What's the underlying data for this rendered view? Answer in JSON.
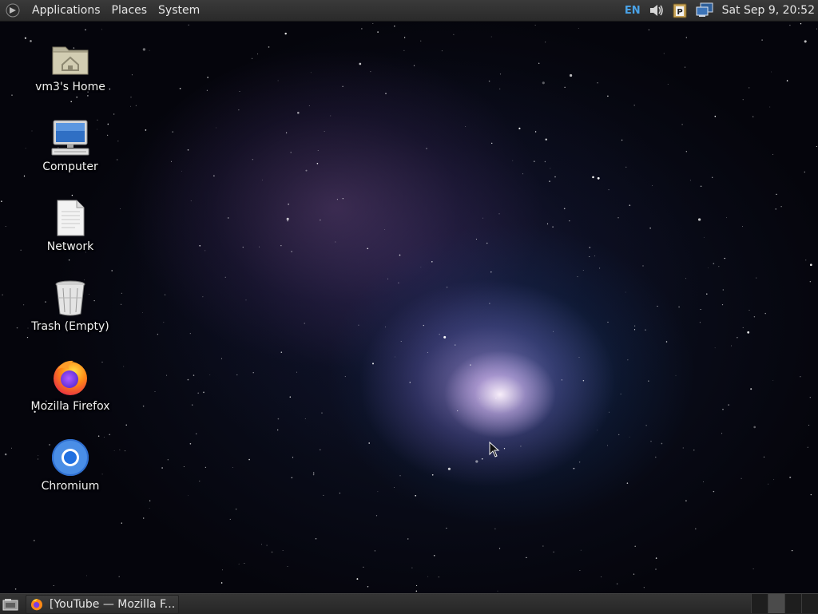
{
  "top_panel": {
    "menus": [
      "Applications",
      "Places",
      "System"
    ],
    "tray": {
      "keyboard_layout": "EN",
      "icons": [
        "volume-icon",
        "clipboard-icon",
        "network-icon"
      ]
    },
    "clock": "Sat Sep  9, 20:52"
  },
  "desktop": {
    "icons": [
      {
        "label": "vm3's Home",
        "icon": "home-folder-icon"
      },
      {
        "label": "Computer",
        "icon": "computer-icon"
      },
      {
        "label": "Network",
        "icon": "network-document-icon"
      },
      {
        "label": "Trash (Empty)",
        "icon": "trash-icon"
      },
      {
        "label": "Mozilla Firefox",
        "icon": "firefox-icon"
      },
      {
        "label": "Chromium",
        "icon": "chromium-icon"
      }
    ]
  },
  "bottom_panel": {
    "taskbar_items": [
      {
        "label": "[YouTube — Mozilla F...",
        "icon": "firefox-icon"
      }
    ],
    "workspace_count": 4,
    "active_workspace": 1
  },
  "colors": {
    "panel": "#2f2f2f",
    "accent_keyboard": "#4aa3e8",
    "text": "#e6e6e6"
  }
}
